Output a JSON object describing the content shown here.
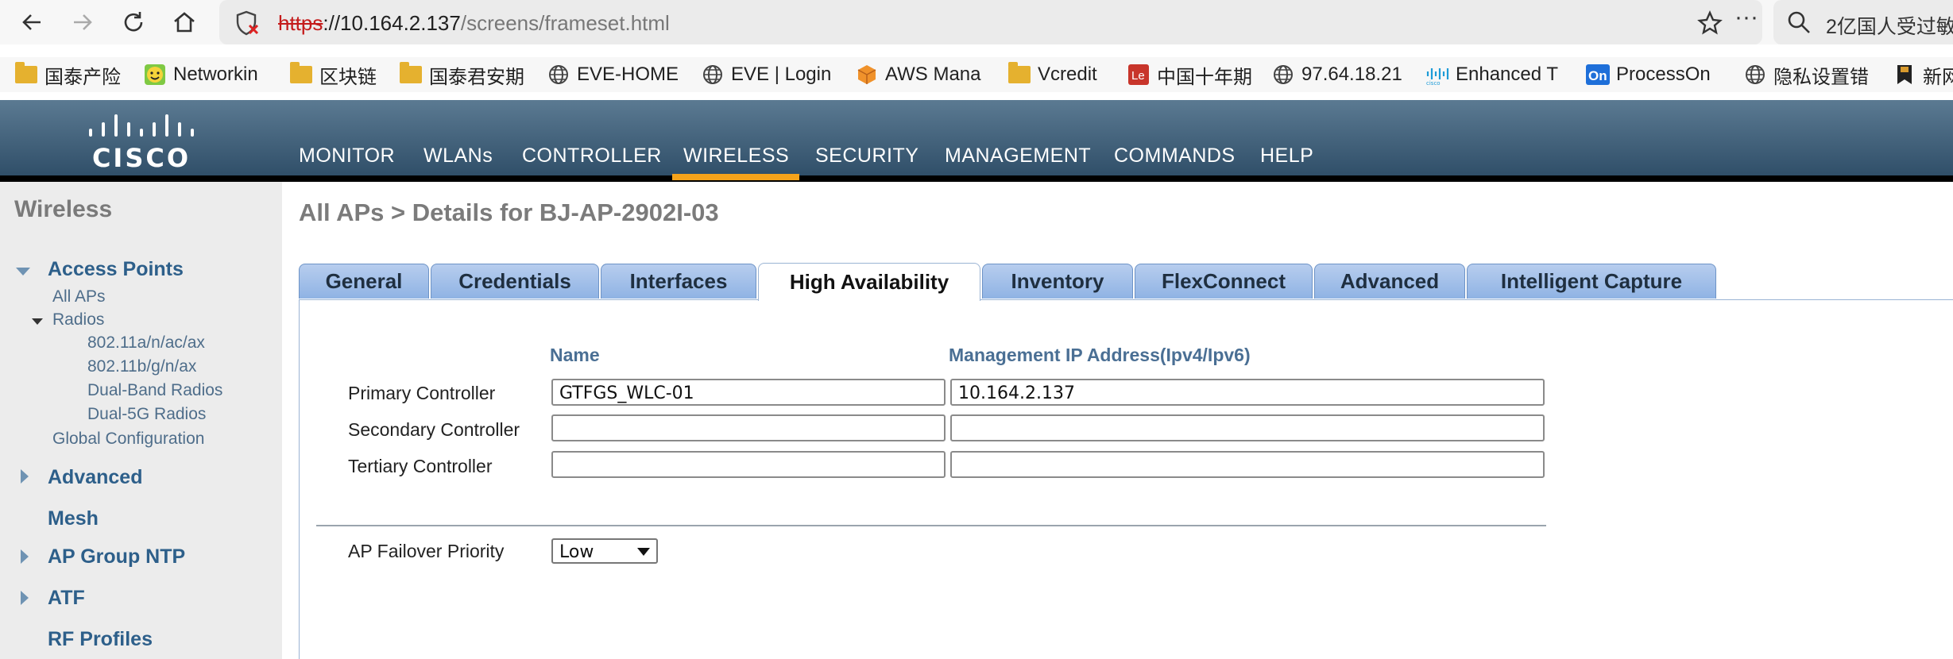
{
  "browser": {
    "url_proto": "https",
    "url_host": "://10.164.2.137",
    "url_path": "/screens/frameset.html",
    "search_text": "2亿国人受过敏"
  },
  "bookmarks": [
    {
      "label": "国泰产险",
      "icon": "folder-icon"
    },
    {
      "label": "Networkin",
      "icon": "smiley-icon"
    },
    {
      "label": "区块链",
      "icon": "folder-icon"
    },
    {
      "label": "国泰君安期",
      "icon": "folder-icon"
    },
    {
      "label": "EVE-HOME",
      "icon": "globe-icon"
    },
    {
      "label": "EVE | Login",
      "icon": "globe-icon"
    },
    {
      "label": "AWS Mana",
      "icon": "aws-cube-icon"
    },
    {
      "label": "Vcredit",
      "icon": "folder-icon"
    },
    {
      "label": "中国十年期",
      "icon": "le-icon"
    },
    {
      "label": "97.64.18.21",
      "icon": "globe-icon"
    },
    {
      "label": "Enhanced T",
      "icon": "cisco-icon"
    },
    {
      "label": "ProcessOn",
      "icon": "on-icon"
    },
    {
      "label": "隐私设置错",
      "icon": "globe-icon"
    },
    {
      "label": "新网",
      "icon": "bookmark-icon"
    }
  ],
  "header": {
    "logo_text": "CISCO",
    "menu": [
      {
        "label": "MONITOR"
      },
      {
        "label": "WLANs"
      },
      {
        "label": "CONTROLLER"
      },
      {
        "label": "WIRELESS"
      },
      {
        "label": "SECURITY"
      },
      {
        "label": "MANAGEMENT"
      },
      {
        "label": "COMMANDS"
      },
      {
        "label": "HELP"
      }
    ],
    "active": "WIRELESS"
  },
  "sidebar": {
    "title": "Wireless",
    "access_points": "Access Points",
    "all_aps": "All APs",
    "radios": "Radios",
    "radio_items": [
      "802.11a/n/ac/ax",
      "802.11b/g/n/ax",
      "Dual-Band Radios",
      "Dual-5G Radios"
    ],
    "global_config": "Global Configuration",
    "advanced": "Advanced",
    "mesh": "Mesh",
    "ap_group_ntp": "AP Group NTP",
    "atf": "ATF",
    "rf_profiles": "RF Profiles"
  },
  "main": {
    "title": "All APs > Details for BJ-AP-2902I-03",
    "tabs": [
      {
        "label": "General"
      },
      {
        "label": "Credentials"
      },
      {
        "label": "Interfaces"
      },
      {
        "label": "High Availability"
      },
      {
        "label": "Inventory"
      },
      {
        "label": "FlexConnect"
      },
      {
        "label": "Advanced"
      },
      {
        "label": "Intelligent Capture"
      }
    ],
    "active_tab": "High Availability",
    "col_name": "Name",
    "col_ip": "Management IP Address(Ipv4/Ipv6)",
    "rows": [
      {
        "label": "Primary Controller",
        "name": "GTFGS_WLC-01",
        "ip": "10.164.2.137"
      },
      {
        "label": "Secondary Controller",
        "name": "",
        "ip": ""
      },
      {
        "label": "Tertiary Controller",
        "name": "",
        "ip": ""
      }
    ],
    "failover_label": "AP Failover Priority",
    "failover_value": "Low"
  }
}
